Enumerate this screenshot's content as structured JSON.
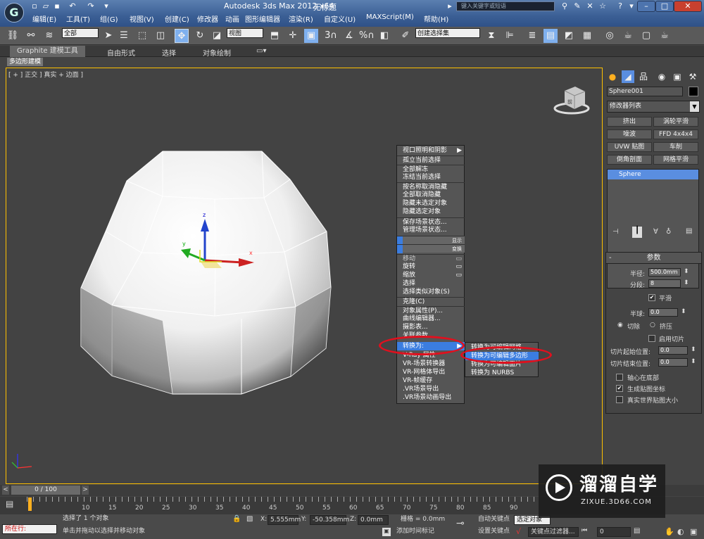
{
  "titlebar": {
    "app_title": "Autodesk 3ds Max  2012 x64",
    "doc_title": "无标题",
    "search_placeholder": "键入关键字或短语",
    "logo_glyph": "G"
  },
  "menubar": [
    "编辑(E)",
    "工具(T)",
    "组(G)",
    "视图(V)",
    "创建(C)",
    "修改器",
    "动画",
    "图形编辑器",
    "渲染(R)",
    "自定义(U)",
    "MAXScript(M)",
    "帮助(H)"
  ],
  "toolbar": {
    "filter_value": "全部",
    "refcoord_value": "视图",
    "selection_set_value": "创建选择集",
    "snap_labels": [
      "3",
      "%"
    ]
  },
  "ribbon": {
    "tabs": [
      "Graphite 建模工具",
      "自由形式",
      "选择",
      "对象绘制"
    ],
    "panel": "多边形建模"
  },
  "viewport": {
    "label": "[ + ] 正交 ] 真实 + 边面 ]",
    "gizmo_axes": [
      "z",
      "y",
      "x"
    ],
    "cube_label": "前"
  },
  "quad_menu": {
    "items": [
      {
        "label": "视口照明和阴影",
        "sub": true
      },
      {
        "label": "孤立当前选择"
      },
      {
        "label": "全部解冻"
      },
      {
        "label": "冻结当前选择"
      },
      {
        "label": "按名称取消隐藏"
      },
      {
        "label": "全部取消隐藏"
      },
      {
        "label": "隐藏未选定对象"
      },
      {
        "label": "隐藏选定对象"
      },
      {
        "label": "保存场景状态..."
      },
      {
        "label": "管理场景状态..."
      },
      {
        "label": ""
      },
      {
        "label": ""
      },
      {
        "label": "移动"
      },
      {
        "label": "旋转"
      },
      {
        "label": "缩放"
      },
      {
        "label": "选择"
      },
      {
        "label": "选择类似对象(S)"
      },
      {
        "label": "克隆(C)"
      },
      {
        "label": "对象属性(P)..."
      },
      {
        "label": "曲线编辑器..."
      },
      {
        "label": "摄影表..."
      },
      {
        "label": "关联参数..."
      },
      {
        "label": "转换为:",
        "sub": true
      },
      {
        "label": "V-Ray 属性"
      },
      {
        "label": "VR-场景转换器"
      },
      {
        "label": "VR-网格体导出"
      },
      {
        "label": "VR-帧缓存"
      },
      {
        "label": ".VR场景导出"
      },
      {
        "label": ".VR场景动画导出"
      }
    ],
    "section_labels": [
      "显示",
      "变换"
    ],
    "submenu": [
      "转换为可编辑网格",
      "转换为可编辑多边形",
      "转换为可编辑面片",
      "转换为 NURBS"
    ]
  },
  "command_panel": {
    "object_name": "Sphere001",
    "modifier_list": "修改器列表",
    "mod_buttons": [
      "挤出",
      "涡轮平滑",
      "噪波",
      "FFD 4x4x4",
      "UVW 贴图",
      "车削",
      "倒角剖面",
      "网格平滑"
    ],
    "stack": [
      "Sphere"
    ],
    "params": {
      "title": "参数",
      "radius_label": "半径:",
      "radius_value": "500.0mm",
      "segments_label": "分段:",
      "segments_value": "8",
      "smooth_label": "平滑",
      "smooth_checked": true,
      "hemisphere_label": "半球:",
      "hemisphere_value": "0.0",
      "chop_label": "切除",
      "squash_label": "挤压",
      "slice_on_label": "启用切片",
      "slice_from_label": "切片起始位置:",
      "slice_from_value": "0.0",
      "slice_to_label": "切片结束位置:",
      "slice_to_value": "0.0",
      "base_pivot_label": "轴心在底部",
      "gen_map_label": "生成贴图坐标",
      "gen_map_checked": true,
      "real_world_label": "真实世界贴图大小"
    }
  },
  "timeline": {
    "frame_display": "0 / 100",
    "ticks": [
      "10",
      "15",
      "20",
      "25",
      "30",
      "35",
      "40",
      "45",
      "50",
      "55",
      "60",
      "65",
      "70",
      "75",
      "80",
      "85",
      "90"
    ]
  },
  "status": {
    "running_label": "所在行:",
    "selected_text": "选择了 1 个对象",
    "prompt_text": "单击并拖动以选择并移动对象",
    "x_value": "5.555mm",
    "y_value": "-50.358mm",
    "z_value": "0.0mm",
    "grid_text": "栅格 = 0.0mm",
    "add_time_tag": "添加时间标记",
    "auto_key": "自动关键点",
    "selected_obj": "选定对象",
    "set_key": "设置关键点",
    "key_filter": "关键点过滤器...",
    "frame_value": "0"
  },
  "watermark": {
    "title": "溜溜自学",
    "url": "ZIXUE.3D66.COM"
  }
}
